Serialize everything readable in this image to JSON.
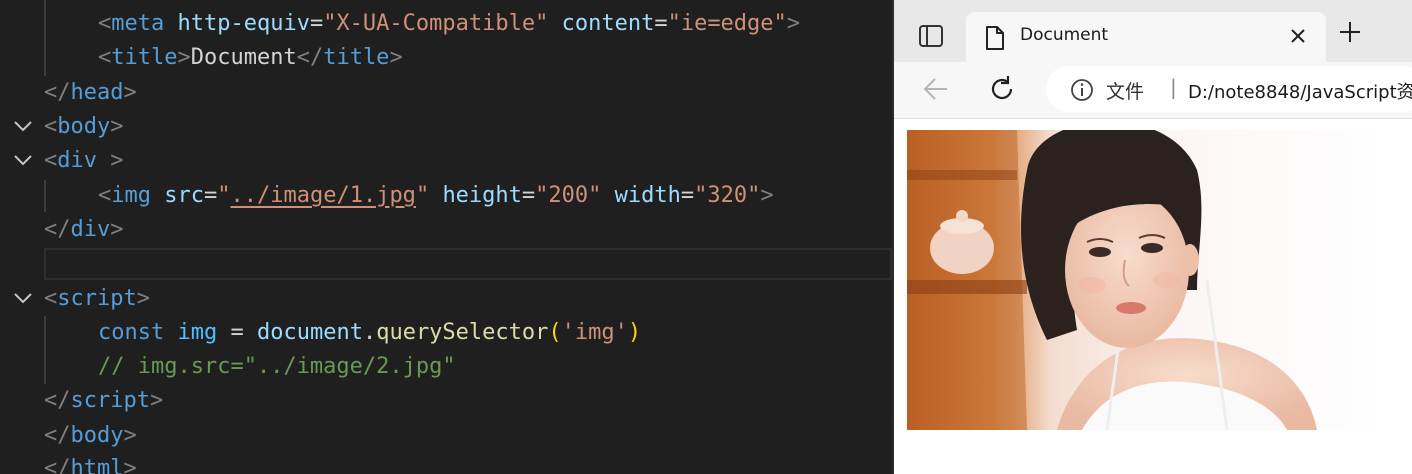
{
  "editor": {
    "lines": {
      "meta": {
        "lt": "<",
        "tag": "meta",
        "attr1": "http-equiv",
        "eq1": "=",
        "val1": "\"X-UA-Compatible\"",
        "attr2": "content",
        "eq2": "=",
        "val2": "\"ie=edge\"",
        "gt": ">"
      },
      "title": {
        "lt": "<",
        "tag": "title",
        "gt": ">",
        "text": "Document",
        "lt2": "</",
        "tag2": "title",
        "gt2": ">"
      },
      "head_close": {
        "lt": "</",
        "tag": "head",
        "gt": ">"
      },
      "body_open": {
        "lt": "<",
        "tag": "body",
        "gt": ">"
      },
      "div_open": {
        "lt": "<",
        "tag": "div",
        "gt": " >"
      },
      "img": {
        "lt": "<",
        "tag": "img",
        "attr1": "src",
        "eq1": "=",
        "q1": "\"",
        "src": "../image/1.jpg",
        "q2": "\"",
        "attr2": "height",
        "eq2": "=",
        "val2": "\"200\"",
        "attr3": "width",
        "eq3": "=",
        "val3": "\"320\"",
        "gt": ">"
      },
      "div_close": {
        "lt": "</",
        "tag": "div",
        "gt": ">"
      },
      "script_open": {
        "lt": "<",
        "tag": "script",
        "gt": ">"
      },
      "const": {
        "kw": "const",
        "var": "img",
        "eq": "=",
        "obj": "document",
        "dot": ".",
        "fn": "querySelector",
        "p1": "(",
        "str": "'img'",
        "p2": ")"
      },
      "comment": {
        "text": "// img.src=\"../image/2.jpg\""
      },
      "script_close": {
        "lt": "</",
        "tag": "script",
        "gt": ">"
      },
      "body_close": {
        "lt": "</",
        "tag": "body",
        "gt": ">"
      },
      "html_close": {
        "lt": "</",
        "tag": "html",
        "gt": ">"
      }
    }
  },
  "browser": {
    "tab": {
      "title": "Document",
      "icon": "document-icon",
      "close_icon": "close-icon"
    },
    "new_tab_icon": "plus-icon",
    "tab_actions_icon": "tab-actions-icon",
    "toolbar": {
      "back_icon": "back-arrow-icon",
      "reload_icon": "reload-icon",
      "address": {
        "info_icon": "info-icon",
        "scheme": "文件",
        "separator": "|",
        "url": "D:/note8848/JavaScript资"
      }
    },
    "viewport": {
      "image_alt": "photo"
    }
  },
  "colors": {
    "editor_bg": "#1f1f1f",
    "tag": "#569cd6",
    "attr": "#9cdcfe",
    "string": "#ce9178",
    "comment": "#6a9955",
    "browser_chrome": "#e8e8e8"
  }
}
